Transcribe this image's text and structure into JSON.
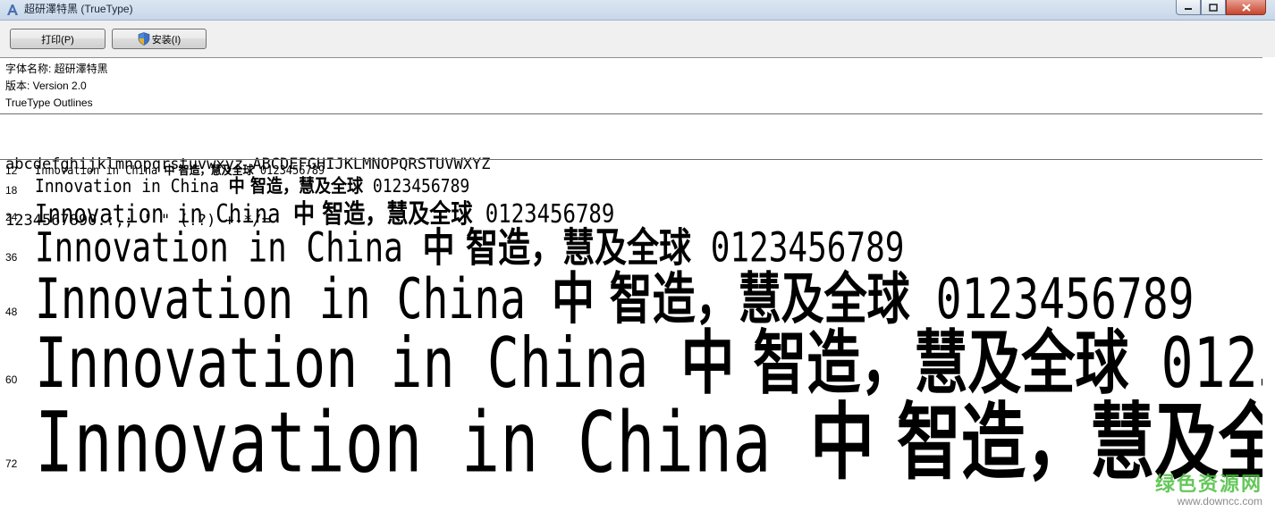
{
  "window": {
    "title": "超研澤特黑 (TrueType)"
  },
  "toolbar": {
    "print_label": "打印(P)",
    "install_label": "安装(I)"
  },
  "info": {
    "font_name": "字体名称: 超研澤特黑",
    "version": "版本: Version 2.0",
    "outline": "TrueType Outlines"
  },
  "charset": {
    "line1": "abcdefghijklmnopqrstuvwxyz ABCDEFGHIJKLMNOPQRSTUVWXYZ",
    "line2": "1234567890.:,; ' \" (!?) +-*/="
  },
  "preview": {
    "latin": "Innovation in China ",
    "cjk": "中  智造，慧及全球",
    "digits": " 0123456789",
    "sizes": [
      "12",
      "18",
      "24",
      "36",
      "48",
      "60",
      "72"
    ]
  },
  "watermark": {
    "brand": "绿色资源网",
    "url": "www.downcc.com"
  }
}
